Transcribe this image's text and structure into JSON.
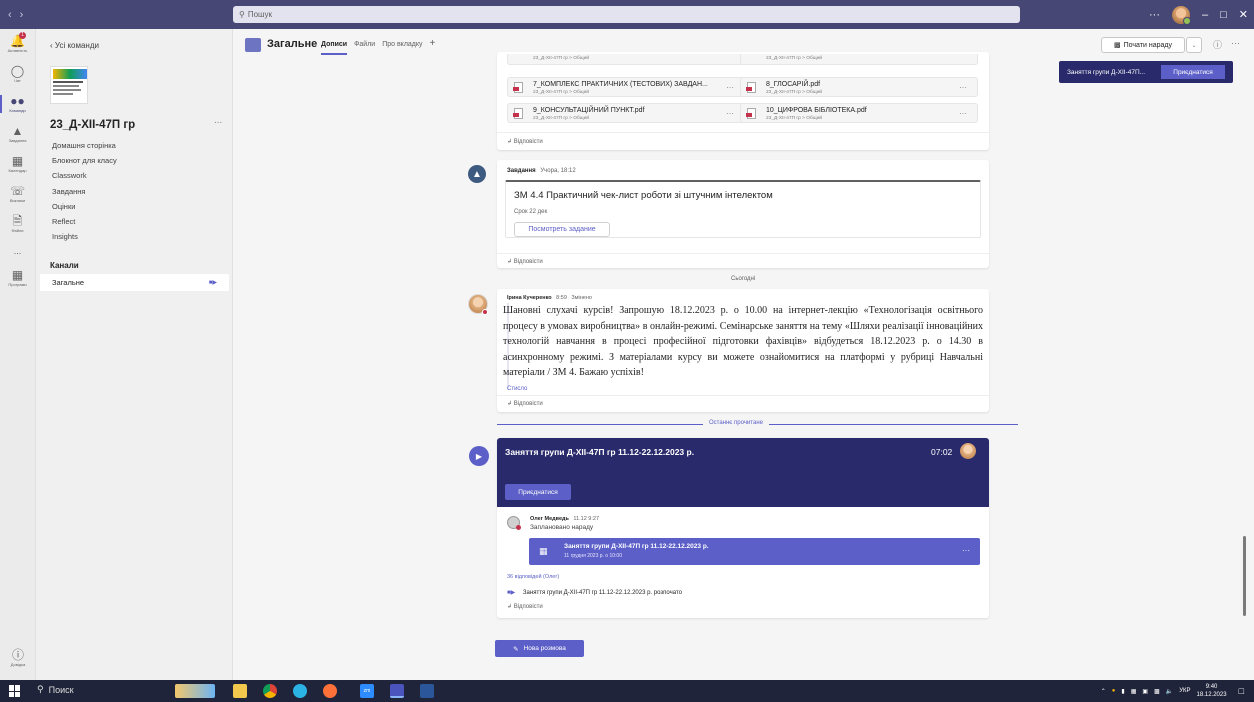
{
  "search": {
    "placeholder": "Пошук"
  },
  "rail": [
    {
      "label": "Активність",
      "badge": "1"
    },
    {
      "label": "Чат"
    },
    {
      "label": "Команди"
    },
    {
      "label": "Завдання"
    },
    {
      "label": "Календар"
    },
    {
      "label": "Виклики"
    },
    {
      "label": "Файли"
    },
    {
      "label": "..."
    },
    {
      "label": "Програми"
    },
    {
      "label": "Довідка"
    }
  ],
  "sidebar": {
    "back_label": "Усі команди",
    "team_name": "23_Д-XII-47П гр",
    "team_more": "...",
    "nav": [
      "Домашня сторінка",
      "Блокнот для класу",
      "Classwork",
      "Завдання",
      "Оцінки",
      "Reflect",
      "Insights"
    ],
    "channels_heading": "Канали",
    "channel": "Загальне"
  },
  "header": {
    "title": "Загальне",
    "tabs": [
      "Дописи",
      "Файли",
      "Про вкладку",
      "+"
    ],
    "meet_button": "Почати нараду"
  },
  "ongoing": {
    "title": "Заняття групи Д-XII-47П...",
    "join": "Приєднатися"
  },
  "files_card": {
    "top_meta": [
      "23_Д-XII-47П гр > Общий",
      "23_Д-XII-47П гр > Общий"
    ],
    "files": [
      {
        "name": "7_КОМПЛЕКС ПРАКТИЧНИХ (ТЕСТОВИХ) ЗАВДАН...",
        "meta": "23_Д-XII-47П гр > Общий"
      },
      {
        "name": "8_ГЛОСАРІЙ.pdf",
        "meta": "23_Д-XII-47П гр > Общий"
      },
      {
        "name": "9_КОНСУЛЬТАЦІЙНИЙ ПУНКТ.pdf",
        "meta": "23_Д-XII-47П гр > Общий"
      },
      {
        "name": "10_ЦИФРОВА БІБЛІОТЕКА.pdf",
        "meta": "23_Д-XII-47П гр > Общий"
      }
    ],
    "reply": "Відповісти"
  },
  "assignment": {
    "source": "Завдання",
    "time": "Учора, 18:12",
    "title": "ЗМ 4.4 Практичний чек-лист роботи зі штучним інтелектом",
    "due": "Срок 22 дек",
    "button": "Посмотреть задание",
    "reply": "Відповісти"
  },
  "today_label": "Сьогодні",
  "post": {
    "author": "Ірина Кучеренко",
    "time": "8:59",
    "edited": "Змінено",
    "text": "Шановні слухачі курсів! Запрошую 18.12.2023 р. о 10.00 на інтернет-лекцію «Технологізація освітнього процесу в умовах виробництва» в онлайн-режимі. Семінарське заняття на тему «Шляхи реалізації інноваційних технологій навчання в процесі професійної підготовки фахівців» відбудеться 18.12.2023 р. о 14.30 в асинхронному режимі. З матеріалами курсу ви можете ознайомитися на платформі у рубриці Навчальні матеріали / ЗМ 4. Бажаю успіхів!",
    "collapse": "Стисло",
    "reply": "Відповісти"
  },
  "last_read": "Останнє прочитане",
  "meeting": {
    "title": "Заняття групи Д-XII-47П гр 11.12-22.12.2023 р.",
    "duration": "07:02",
    "join": "Приєднатися",
    "organizer": "Олег Медведь",
    "org_time": "11.12 9:27",
    "scheduled": "Заплановано нараду",
    "event_title": "Заняття групи Д-XII-47П гр 11.12-22.12.2023 р.",
    "event_time": "11 грудня 2023 р. о 10:00",
    "replies": "36 відповідей (Олег)",
    "started": "Заняття групи Д-XII-47П гр 11.12-22.12.2023 р. розпочато",
    "reply": "Відповісти"
  },
  "new_conversation": "Нова розмова",
  "taskbar": {
    "search": "Поиск",
    "lang": "УКР",
    "time": "9:40",
    "date": "18.12.2023"
  },
  "colors": {
    "brand": "#5b5fc7",
    "titlebar": "#464775",
    "meeting_card": "#292a6b",
    "taskbar": "#20243a"
  }
}
